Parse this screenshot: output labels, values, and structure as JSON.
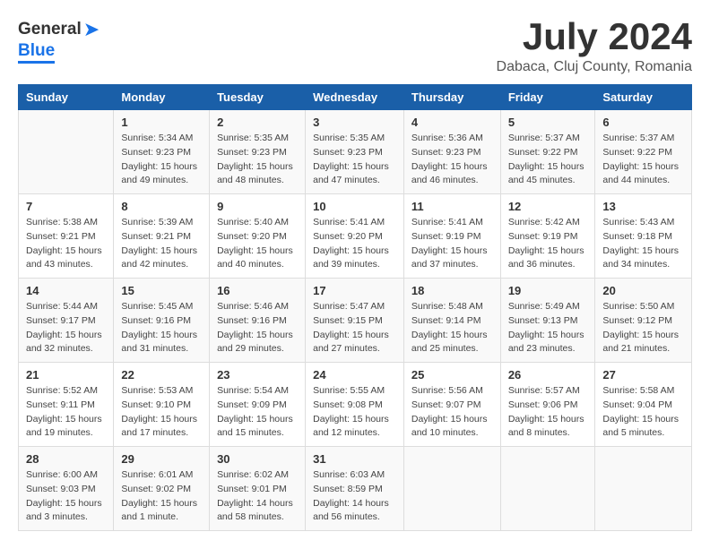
{
  "header": {
    "logo_general": "General",
    "logo_blue": "Blue",
    "month_title": "July 2024",
    "subtitle": "Dabaca, Cluj County, Romania"
  },
  "columns": [
    "Sunday",
    "Monday",
    "Tuesday",
    "Wednesday",
    "Thursday",
    "Friday",
    "Saturday"
  ],
  "weeks": [
    [
      {
        "day": "",
        "info": ""
      },
      {
        "day": "1",
        "info": "Sunrise: 5:34 AM\nSunset: 9:23 PM\nDaylight: 15 hours\nand 49 minutes."
      },
      {
        "day": "2",
        "info": "Sunrise: 5:35 AM\nSunset: 9:23 PM\nDaylight: 15 hours\nand 48 minutes."
      },
      {
        "day": "3",
        "info": "Sunrise: 5:35 AM\nSunset: 9:23 PM\nDaylight: 15 hours\nand 47 minutes."
      },
      {
        "day": "4",
        "info": "Sunrise: 5:36 AM\nSunset: 9:23 PM\nDaylight: 15 hours\nand 46 minutes."
      },
      {
        "day": "5",
        "info": "Sunrise: 5:37 AM\nSunset: 9:22 PM\nDaylight: 15 hours\nand 45 minutes."
      },
      {
        "day": "6",
        "info": "Sunrise: 5:37 AM\nSunset: 9:22 PM\nDaylight: 15 hours\nand 44 minutes."
      }
    ],
    [
      {
        "day": "7",
        "info": "Sunrise: 5:38 AM\nSunset: 9:21 PM\nDaylight: 15 hours\nand 43 minutes."
      },
      {
        "day": "8",
        "info": "Sunrise: 5:39 AM\nSunset: 9:21 PM\nDaylight: 15 hours\nand 42 minutes."
      },
      {
        "day": "9",
        "info": "Sunrise: 5:40 AM\nSunset: 9:20 PM\nDaylight: 15 hours\nand 40 minutes."
      },
      {
        "day": "10",
        "info": "Sunrise: 5:41 AM\nSunset: 9:20 PM\nDaylight: 15 hours\nand 39 minutes."
      },
      {
        "day": "11",
        "info": "Sunrise: 5:41 AM\nSunset: 9:19 PM\nDaylight: 15 hours\nand 37 minutes."
      },
      {
        "day": "12",
        "info": "Sunrise: 5:42 AM\nSunset: 9:19 PM\nDaylight: 15 hours\nand 36 minutes."
      },
      {
        "day": "13",
        "info": "Sunrise: 5:43 AM\nSunset: 9:18 PM\nDaylight: 15 hours\nand 34 minutes."
      }
    ],
    [
      {
        "day": "14",
        "info": "Sunrise: 5:44 AM\nSunset: 9:17 PM\nDaylight: 15 hours\nand 32 minutes."
      },
      {
        "day": "15",
        "info": "Sunrise: 5:45 AM\nSunset: 9:16 PM\nDaylight: 15 hours\nand 31 minutes."
      },
      {
        "day": "16",
        "info": "Sunrise: 5:46 AM\nSunset: 9:16 PM\nDaylight: 15 hours\nand 29 minutes."
      },
      {
        "day": "17",
        "info": "Sunrise: 5:47 AM\nSunset: 9:15 PM\nDaylight: 15 hours\nand 27 minutes."
      },
      {
        "day": "18",
        "info": "Sunrise: 5:48 AM\nSunset: 9:14 PM\nDaylight: 15 hours\nand 25 minutes."
      },
      {
        "day": "19",
        "info": "Sunrise: 5:49 AM\nSunset: 9:13 PM\nDaylight: 15 hours\nand 23 minutes."
      },
      {
        "day": "20",
        "info": "Sunrise: 5:50 AM\nSunset: 9:12 PM\nDaylight: 15 hours\nand 21 minutes."
      }
    ],
    [
      {
        "day": "21",
        "info": "Sunrise: 5:52 AM\nSunset: 9:11 PM\nDaylight: 15 hours\nand 19 minutes."
      },
      {
        "day": "22",
        "info": "Sunrise: 5:53 AM\nSunset: 9:10 PM\nDaylight: 15 hours\nand 17 minutes."
      },
      {
        "day": "23",
        "info": "Sunrise: 5:54 AM\nSunset: 9:09 PM\nDaylight: 15 hours\nand 15 minutes."
      },
      {
        "day": "24",
        "info": "Sunrise: 5:55 AM\nSunset: 9:08 PM\nDaylight: 15 hours\nand 12 minutes."
      },
      {
        "day": "25",
        "info": "Sunrise: 5:56 AM\nSunset: 9:07 PM\nDaylight: 15 hours\nand 10 minutes."
      },
      {
        "day": "26",
        "info": "Sunrise: 5:57 AM\nSunset: 9:06 PM\nDaylight: 15 hours\nand 8 minutes."
      },
      {
        "day": "27",
        "info": "Sunrise: 5:58 AM\nSunset: 9:04 PM\nDaylight: 15 hours\nand 5 minutes."
      }
    ],
    [
      {
        "day": "28",
        "info": "Sunrise: 6:00 AM\nSunset: 9:03 PM\nDaylight: 15 hours\nand 3 minutes."
      },
      {
        "day": "29",
        "info": "Sunrise: 6:01 AM\nSunset: 9:02 PM\nDaylight: 15 hours\nand 1 minute."
      },
      {
        "day": "30",
        "info": "Sunrise: 6:02 AM\nSunset: 9:01 PM\nDaylight: 14 hours\nand 58 minutes."
      },
      {
        "day": "31",
        "info": "Sunrise: 6:03 AM\nSunset: 8:59 PM\nDaylight: 14 hours\nand 56 minutes."
      },
      {
        "day": "",
        "info": ""
      },
      {
        "day": "",
        "info": ""
      },
      {
        "day": "",
        "info": ""
      }
    ]
  ]
}
